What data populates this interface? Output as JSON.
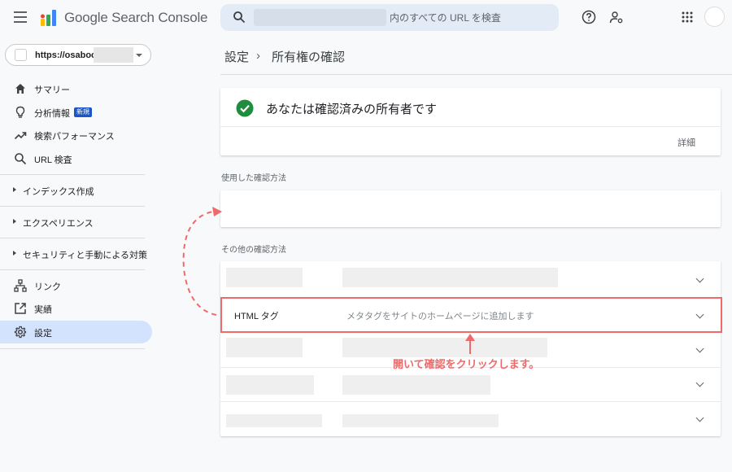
{
  "app": {
    "title": "Google Search Console",
    "search_placeholder": "内のすべての URL を検査"
  },
  "property": {
    "name": "https://osaboo"
  },
  "sidebar": {
    "items": [
      {
        "label": "サマリー",
        "icon": "home-icon"
      },
      {
        "label": "分析情報",
        "icon": "lightbulb-icon",
        "badge": "新規"
      },
      {
        "label": "検索パフォーマンス",
        "icon": "trending-icon"
      },
      {
        "label": "URL 検査",
        "icon": "search-icon"
      }
    ],
    "sections": [
      "インデックス作成",
      "エクスペリエンス",
      "セキュリティと手動による対策"
    ],
    "bottom": [
      {
        "label": "リンク",
        "icon": "sitemap-icon"
      },
      {
        "label": "実績",
        "icon": "open-in-new-icon"
      },
      {
        "label": "設定",
        "icon": "gear-icon",
        "active": true
      }
    ]
  },
  "breadcrumb": {
    "parent": "設定",
    "separator": "›",
    "current": "所有権の確認"
  },
  "owner": {
    "message": "あなたは確認済みの所有者です",
    "details_label": "詳細"
  },
  "verification": {
    "used_label": "使用した確認方法",
    "other_label": "その他の確認方法",
    "html_tag": {
      "label": "HTML タグ",
      "description": "メタタグをサイトのホームページに追加します"
    }
  },
  "annotation": {
    "text": "開いて確認をクリックします。",
    "color": "#ee6a6a"
  },
  "colors": {
    "active_nav": "#d3e3fd",
    "check": "#1e8e3e",
    "highlight": "#ef6b6b"
  }
}
